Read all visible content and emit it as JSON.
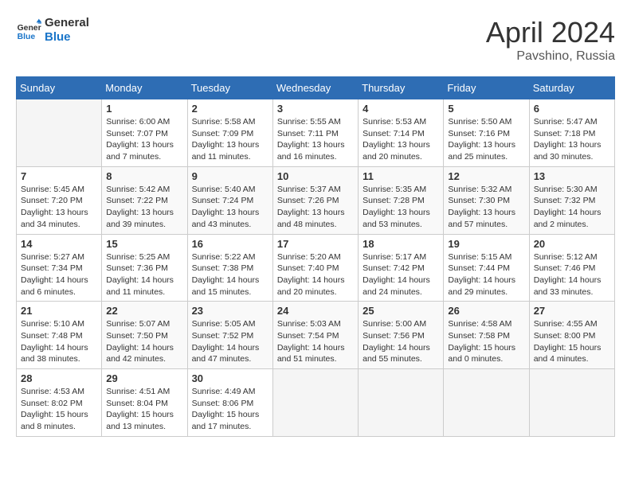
{
  "header": {
    "logo_line1": "General",
    "logo_line2": "Blue",
    "title": "April 2024",
    "location": "Pavshino, Russia"
  },
  "calendar": {
    "days_of_week": [
      "Sunday",
      "Monday",
      "Tuesday",
      "Wednesday",
      "Thursday",
      "Friday",
      "Saturday"
    ],
    "weeks": [
      [
        {
          "day": "",
          "info": ""
        },
        {
          "day": "1",
          "info": "Sunrise: 6:00 AM\nSunset: 7:07 PM\nDaylight: 13 hours\nand 7 minutes."
        },
        {
          "day": "2",
          "info": "Sunrise: 5:58 AM\nSunset: 7:09 PM\nDaylight: 13 hours\nand 11 minutes."
        },
        {
          "day": "3",
          "info": "Sunrise: 5:55 AM\nSunset: 7:11 PM\nDaylight: 13 hours\nand 16 minutes."
        },
        {
          "day": "4",
          "info": "Sunrise: 5:53 AM\nSunset: 7:14 PM\nDaylight: 13 hours\nand 20 minutes."
        },
        {
          "day": "5",
          "info": "Sunrise: 5:50 AM\nSunset: 7:16 PM\nDaylight: 13 hours\nand 25 minutes."
        },
        {
          "day": "6",
          "info": "Sunrise: 5:47 AM\nSunset: 7:18 PM\nDaylight: 13 hours\nand 30 minutes."
        }
      ],
      [
        {
          "day": "7",
          "info": "Sunrise: 5:45 AM\nSunset: 7:20 PM\nDaylight: 13 hours\nand 34 minutes."
        },
        {
          "day": "8",
          "info": "Sunrise: 5:42 AM\nSunset: 7:22 PM\nDaylight: 13 hours\nand 39 minutes."
        },
        {
          "day": "9",
          "info": "Sunrise: 5:40 AM\nSunset: 7:24 PM\nDaylight: 13 hours\nand 43 minutes."
        },
        {
          "day": "10",
          "info": "Sunrise: 5:37 AM\nSunset: 7:26 PM\nDaylight: 13 hours\nand 48 minutes."
        },
        {
          "day": "11",
          "info": "Sunrise: 5:35 AM\nSunset: 7:28 PM\nDaylight: 13 hours\nand 53 minutes."
        },
        {
          "day": "12",
          "info": "Sunrise: 5:32 AM\nSunset: 7:30 PM\nDaylight: 13 hours\nand 57 minutes."
        },
        {
          "day": "13",
          "info": "Sunrise: 5:30 AM\nSunset: 7:32 PM\nDaylight: 14 hours\nand 2 minutes."
        }
      ],
      [
        {
          "day": "14",
          "info": "Sunrise: 5:27 AM\nSunset: 7:34 PM\nDaylight: 14 hours\nand 6 minutes."
        },
        {
          "day": "15",
          "info": "Sunrise: 5:25 AM\nSunset: 7:36 PM\nDaylight: 14 hours\nand 11 minutes."
        },
        {
          "day": "16",
          "info": "Sunrise: 5:22 AM\nSunset: 7:38 PM\nDaylight: 14 hours\nand 15 minutes."
        },
        {
          "day": "17",
          "info": "Sunrise: 5:20 AM\nSunset: 7:40 PM\nDaylight: 14 hours\nand 20 minutes."
        },
        {
          "day": "18",
          "info": "Sunrise: 5:17 AM\nSunset: 7:42 PM\nDaylight: 14 hours\nand 24 minutes."
        },
        {
          "day": "19",
          "info": "Sunrise: 5:15 AM\nSunset: 7:44 PM\nDaylight: 14 hours\nand 29 minutes."
        },
        {
          "day": "20",
          "info": "Sunrise: 5:12 AM\nSunset: 7:46 PM\nDaylight: 14 hours\nand 33 minutes."
        }
      ],
      [
        {
          "day": "21",
          "info": "Sunrise: 5:10 AM\nSunset: 7:48 PM\nDaylight: 14 hours\nand 38 minutes."
        },
        {
          "day": "22",
          "info": "Sunrise: 5:07 AM\nSunset: 7:50 PM\nDaylight: 14 hours\nand 42 minutes."
        },
        {
          "day": "23",
          "info": "Sunrise: 5:05 AM\nSunset: 7:52 PM\nDaylight: 14 hours\nand 47 minutes."
        },
        {
          "day": "24",
          "info": "Sunrise: 5:03 AM\nSunset: 7:54 PM\nDaylight: 14 hours\nand 51 minutes."
        },
        {
          "day": "25",
          "info": "Sunrise: 5:00 AM\nSunset: 7:56 PM\nDaylight: 14 hours\nand 55 minutes."
        },
        {
          "day": "26",
          "info": "Sunrise: 4:58 AM\nSunset: 7:58 PM\nDaylight: 15 hours\nand 0 minutes."
        },
        {
          "day": "27",
          "info": "Sunrise: 4:55 AM\nSunset: 8:00 PM\nDaylight: 15 hours\nand 4 minutes."
        }
      ],
      [
        {
          "day": "28",
          "info": "Sunrise: 4:53 AM\nSunset: 8:02 PM\nDaylight: 15 hours\nand 8 minutes."
        },
        {
          "day": "29",
          "info": "Sunrise: 4:51 AM\nSunset: 8:04 PM\nDaylight: 15 hours\nand 13 minutes."
        },
        {
          "day": "30",
          "info": "Sunrise: 4:49 AM\nSunset: 8:06 PM\nDaylight: 15 hours\nand 17 minutes."
        },
        {
          "day": "",
          "info": ""
        },
        {
          "day": "",
          "info": ""
        },
        {
          "day": "",
          "info": ""
        },
        {
          "day": "",
          "info": ""
        }
      ]
    ]
  }
}
